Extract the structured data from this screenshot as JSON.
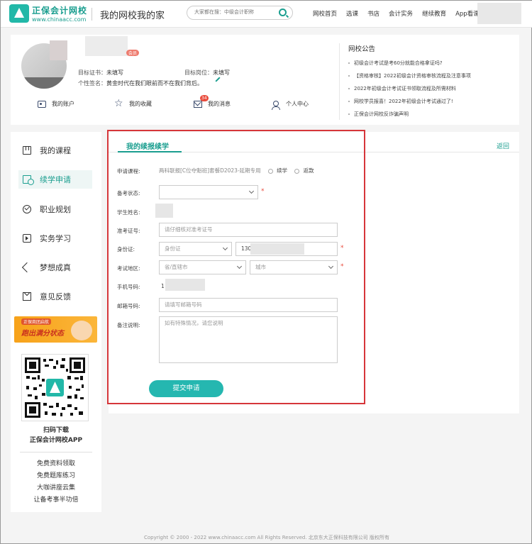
{
  "header": {
    "logo_cn": "正保会计网校",
    "logo_en": "www.chinaacc.com",
    "slogan": "我的网校我的家",
    "search_placeholder": "大家都在搜：中级会计职称",
    "nav": [
      "网校首页",
      "选课",
      "书店",
      "会计实务",
      "继续教育",
      "App看课"
    ]
  },
  "profile": {
    "vip_badge": "会员",
    "target_cert_label": "目标证书：",
    "target_cert_value": "未填写",
    "target_post_label": "目标岗位：",
    "target_post_value": "未填写",
    "signature_label": "个性签名：",
    "signature_value": "黄金时代在我们眼前而不在我们背后。",
    "quick_links": [
      {
        "label": "我的账户"
      },
      {
        "label": "我的收藏"
      },
      {
        "label": "我的消息",
        "badge": "34"
      },
      {
        "label": "个人中心"
      }
    ]
  },
  "notice": {
    "title": "网校公告",
    "items": [
      "初级会计考试是考60分就能合格拿证吗?",
      "【资格审核】2022初级会计资格审核流程及注意事项",
      "2022年初级会计考试证书领取流程及所需材料",
      "网校学员报喜！2022年初级会计考试通过了!",
      "正保会计网校反诈骗声明"
    ]
  },
  "sidebar": {
    "items": [
      {
        "label": "我的课程",
        "icon": "book-icon"
      },
      {
        "label": "续学申请",
        "icon": "doc-search-icon",
        "active": true
      },
      {
        "label": "职业规划",
        "icon": "check-circle-icon"
      },
      {
        "label": "实务学习",
        "icon": "play-icon"
      },
      {
        "label": "梦想成真",
        "icon": "send-icon"
      },
      {
        "label": "意见反馈",
        "icon": "mail-icon"
      }
    ],
    "banner_small": "正保商团启航",
    "banner_big": "跑出满分状态",
    "qr_label1": "扫码下载",
    "qr_label2": "正保会计网校APP",
    "links": [
      "免费资料领取",
      "免费题库练习",
      "大咖讲座云集",
      "让备考事半功倍"
    ]
  },
  "form": {
    "tab": "我的续报续学",
    "back": "返回",
    "course_label": "申请课程:",
    "course_value": "两科联报[C位夺魁班]套餐D2023-延期专用",
    "opt_continue": "续学",
    "opt_refund": "返款",
    "status_label": "备考状态:",
    "student_label": "学生姓名:",
    "ticket_label": "准考证号:",
    "ticket_placeholder": "请仔细核对准考证号",
    "id_label": "身份证:",
    "id_type": "身份证",
    "id_prefix": "130",
    "region_label": "考试地区:",
    "province_placeholder": "省/直辖市",
    "city_placeholder": "城市",
    "phone_label": "手机号码:",
    "phone_prefix": "1",
    "email_label": "邮箱号码:",
    "email_placeholder": "请填写邮箱号码",
    "remark_label": "备注说明:",
    "remark_placeholder": "如有特殊情况，请您说明",
    "submit": "提交申请"
  },
  "footer": "Copyright © 2000 - 2022 www.chinaacc.com All Rights Reserved. 北京东大正保科技有限公司 版权所有"
}
